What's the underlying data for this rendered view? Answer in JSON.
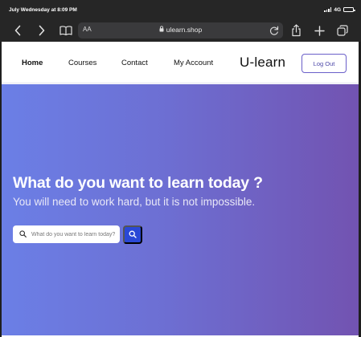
{
  "status_bar": {
    "datetime": "July Wednesday at 8:09 PM",
    "network": "4G"
  },
  "browser": {
    "text_size_label": "AA",
    "url": "ulearn.shop",
    "icons": [
      "chevron-left-icon",
      "chevron-right-icon",
      "book-icon",
      "lock-icon",
      "reload-icon",
      "share-icon",
      "plus-icon",
      "tabs-icon"
    ]
  },
  "nav": {
    "links": [
      {
        "label": "Home",
        "active": true
      },
      {
        "label": "Courses"
      },
      {
        "label": "Contact"
      },
      {
        "label": "My Account"
      }
    ],
    "brand": "U-learn",
    "logout_label": "Log Out"
  },
  "hero": {
    "title": "What do you want to learn today ?",
    "subtitle": "You will need to work hard, but it is not impossible.",
    "search_placeholder": "What do you want to learn today?",
    "search_value": ""
  },
  "colors": {
    "hero_start": "#6b7fe6",
    "hero_end": "#7253b1",
    "search_button": "#2a48d6",
    "logout_border": "#6a5fc9"
  }
}
